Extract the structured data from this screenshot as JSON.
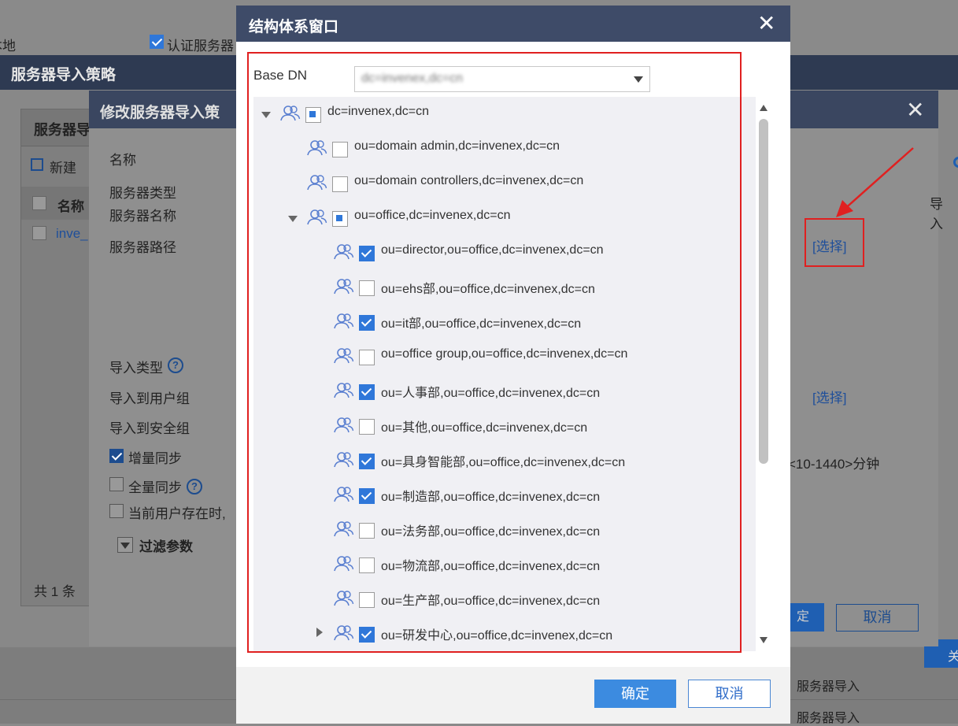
{
  "background": {
    "top_bar": {
      "local_text": "本地",
      "auth_checkbox_label": "认证服务器"
    },
    "policy_window": {
      "title": "服务器导入策略",
      "panel_title": "服务器导",
      "new_button": "新建",
      "col_name": "名称",
      "row_name": "inve_",
      "footer_count": "共 1 条",
      "bottom_right_btn": "关"
    },
    "bottom_list": [
      "服务器导入",
      "服务器导入"
    ]
  },
  "edit_dialog": {
    "title": "修改服务器导入策",
    "fields": {
      "name": "名称",
      "server_type": "服务器类型",
      "server_name": "服务器名称",
      "server_path": "服务器路径",
      "import_type": "导入类型",
      "import_to_user_group": "导入到用户组",
      "import_to_security_group": "导入到安全组",
      "incremental_sync": "增量同步",
      "full_sync": "全量同步",
      "existing_user": "当前用户存在时,",
      "filter_params": "过滤参数"
    },
    "right": {
      "select_link_1": "[选择]",
      "select_link_2": "[选择]",
      "interval_text": "<10-1440>分钟",
      "col_import_partial": "导入",
      "ok_partial": "定",
      "cancel": "取消"
    }
  },
  "structure_window": {
    "title": "结构体系窗口",
    "base_dn_label": "Base DN",
    "base_dn_value": "dc=invenex,dc=cn",
    "tree": [
      {
        "label": "dc=invenex,dc=cn",
        "level": 0,
        "checked": "partial",
        "expanded": true
      },
      {
        "label": "ou=domain admin,dc=invenex,dc=cn",
        "level": 1,
        "checked": "none"
      },
      {
        "label": "ou=domain controllers,dc=invenex,dc=cn",
        "level": 1,
        "checked": "none"
      },
      {
        "label": "ou=office,dc=invenex,dc=cn",
        "level": 1,
        "checked": "partial",
        "expanded": true
      },
      {
        "label": "ou=director,ou=office,dc=invenex,dc=cn",
        "level": 2,
        "checked": "checked"
      },
      {
        "label": "ou=ehs部,ou=office,dc=invenex,dc=cn",
        "level": 2,
        "checked": "none"
      },
      {
        "label": "ou=it部,ou=office,dc=invenex,dc=cn",
        "level": 2,
        "checked": "checked"
      },
      {
        "label": "ou=office group,ou=office,dc=invenex,dc=cn",
        "level": 2,
        "checked": "none"
      },
      {
        "label": "ou=人事部,ou=office,dc=invenex,dc=cn",
        "level": 2,
        "checked": "checked"
      },
      {
        "label": "ou=其他,ou=office,dc=invenex,dc=cn",
        "level": 2,
        "checked": "none"
      },
      {
        "label": "ou=具身智能部,ou=office,dc=invenex,dc=cn",
        "level": 2,
        "checked": "checked"
      },
      {
        "label": "ou=制造部,ou=office,dc=invenex,dc=cn",
        "level": 2,
        "checked": "checked"
      },
      {
        "label": "ou=法务部,ou=office,dc=invenex,dc=cn",
        "level": 2,
        "checked": "none"
      },
      {
        "label": "ou=物流部,ou=office,dc=invenex,dc=cn",
        "level": 2,
        "checked": "none"
      },
      {
        "label": "ou=生产部,ou=office,dc=invenex,dc=cn",
        "level": 2,
        "checked": "none"
      },
      {
        "label": "ou=研发中心,ou=office,dc=invenex,dc=cn",
        "level": 2,
        "checked": "checked",
        "collapsed_arrow": true
      }
    ],
    "ok_button": "确定",
    "cancel_button": "取消"
  },
  "colors": {
    "accent": "#3c8be0",
    "header_dark": "#3e4b68",
    "highlight_red": "#e02020"
  }
}
